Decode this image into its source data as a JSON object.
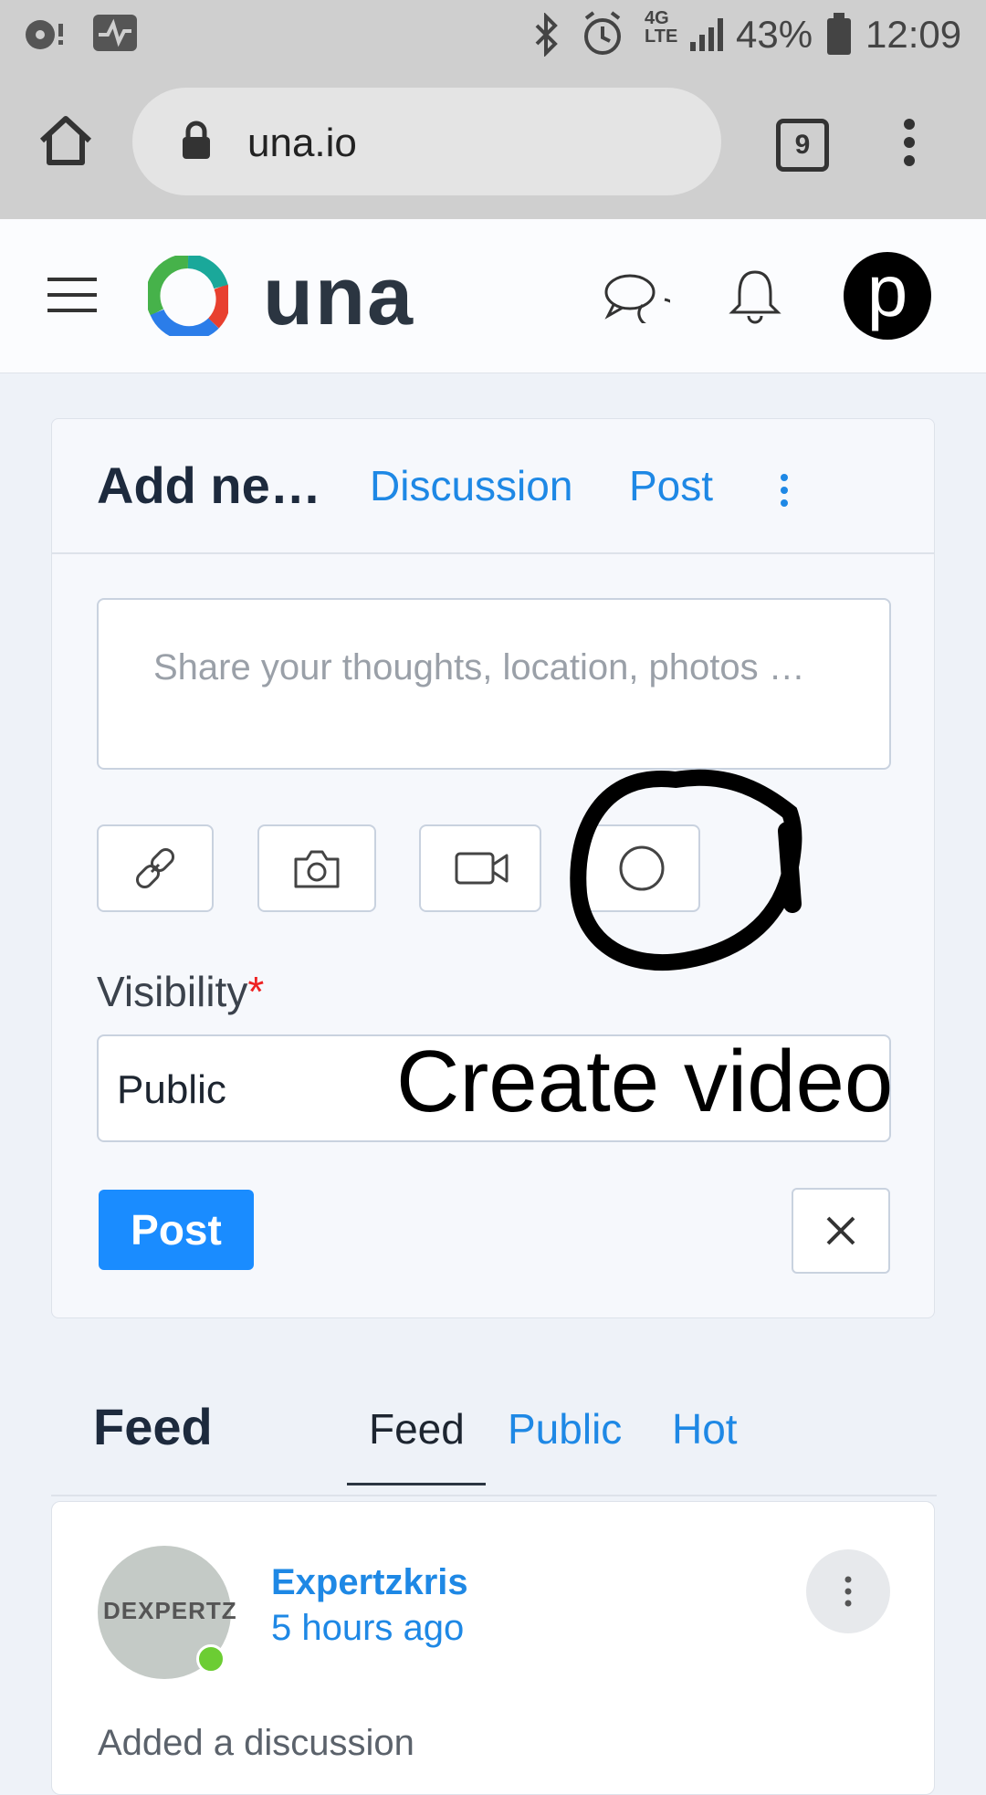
{
  "status_bar": {
    "battery": "43%",
    "time": "12:09",
    "network": "4G LTE"
  },
  "browser": {
    "url": "una.io",
    "tab_count": "9"
  },
  "site": {
    "brand": "una",
    "avatar_letter": "p"
  },
  "composer": {
    "title": "Add ne…",
    "tabs": [
      "Discussion",
      "Post"
    ],
    "placeholder": "Share your thoughts, location, photos …",
    "tools": [
      "link-icon",
      "camera-icon",
      "video-icon",
      "record-circle-icon"
    ],
    "visibility_label": "Visibility",
    "visibility_required": "*",
    "visibility_value": "Public",
    "post_label": "Post",
    "cancel_label": "✕"
  },
  "annotation": {
    "text": "Create video"
  },
  "feed": {
    "title": "Feed",
    "tabs": [
      "Feed",
      "Public",
      "Hot"
    ],
    "active_tab": "Feed",
    "items": [
      {
        "author": "Expertzkris",
        "time": "5 hours ago",
        "avatar_text": "DEXPERTZ",
        "action": "Added a discussion",
        "online": true
      }
    ]
  },
  "colors": {
    "accent": "#1e88e5",
    "post_button": "#1a8cff",
    "online": "#6ccd33"
  }
}
